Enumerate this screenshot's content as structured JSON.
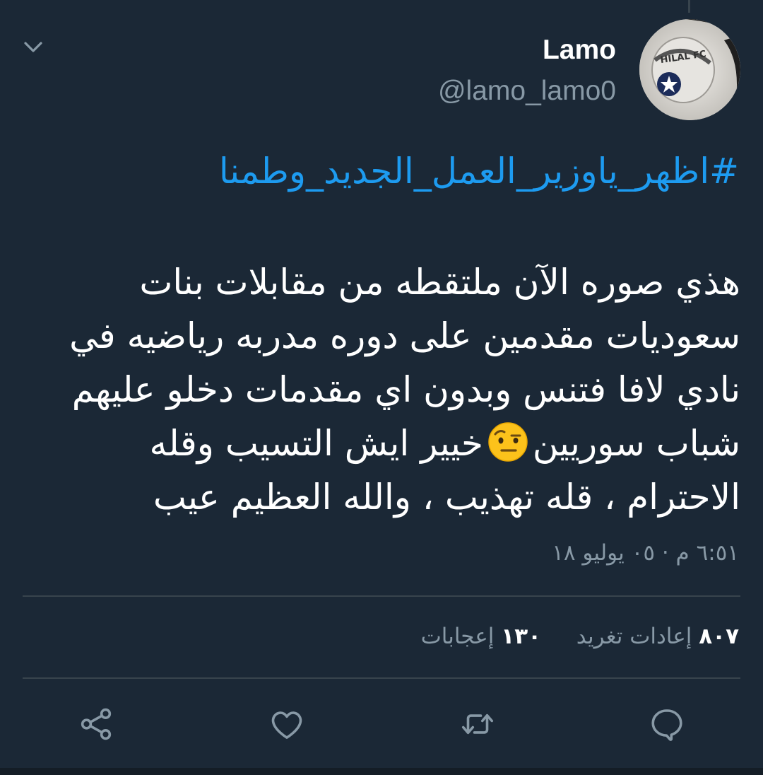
{
  "author": {
    "display_name": "Lamo",
    "handle": "@lamo_lamo0"
  },
  "tweet": {
    "hashtag": "#اظهر_ياوزير_العمل_الجديد_وطمنا",
    "lines": [
      "هذي صوره الآن ملتقطه من مقابلات بنات",
      "سعوديات مقدمين على دوره مدربه رياضيه في",
      "نادي لافا فتنس وبدون اي مقدمات دخلو عليهم",
      "شباب سوريين",
      "خيير ايش التسيب وقله",
      "الاحترام ، قله تهذيب ، والله العظيم عيب"
    ],
    "emoji_name": "face-with-raised-eyebrow-emoji",
    "timestamp": "٦:٥١ م · ٠٥ يوليو ١٨"
  },
  "stats": {
    "retweets_count": "٨٠٧",
    "retweets_label": "إعادات تغريد",
    "likes_count": "١٣٠",
    "likes_label": "إعجابات"
  },
  "actions": {
    "icons": [
      "reply-icon",
      "retweet-icon",
      "like-icon",
      "share-icon"
    ]
  },
  "colors": {
    "background": "#1b2836",
    "hashtag": "#1d9bf0",
    "secondary_text": "#8899a6",
    "divider": "#38444d"
  }
}
